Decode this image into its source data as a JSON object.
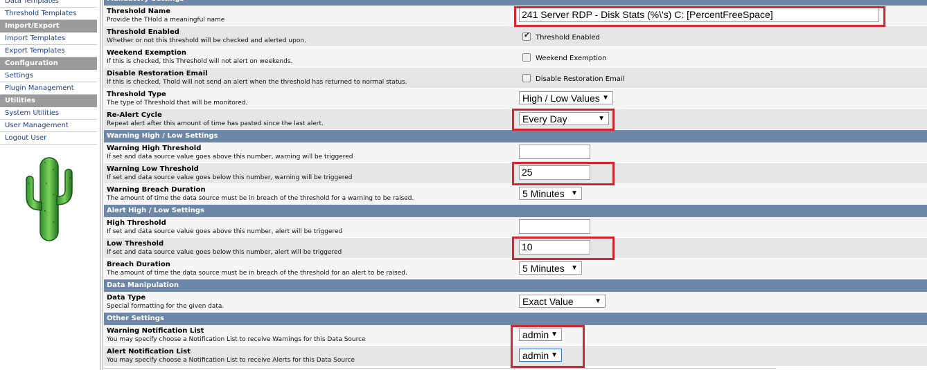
{
  "sidebar": {
    "links_top": [
      {
        "label": "Data Templates"
      },
      {
        "label": "Threshold Templates"
      }
    ],
    "groups": [
      {
        "header": "Import/Export",
        "items": [
          {
            "label": "Import Templates"
          },
          {
            "label": "Export Templates"
          }
        ]
      },
      {
        "header": "Configuration",
        "items": [
          {
            "label": "Settings"
          },
          {
            "label": "Plugin Management"
          }
        ]
      },
      {
        "header": "Utilities",
        "items": [
          {
            "label": "System Utilities"
          },
          {
            "label": "User Management"
          },
          {
            "label": "Logout User"
          }
        ]
      }
    ],
    "logo": "cactus-logo"
  },
  "sections": {
    "mandatory": "Mandatory Settings",
    "warning": "Warning High / Low Settings",
    "alert": "Alert High / Low Settings",
    "data_manip": "Data Manipulation",
    "other": "Other Settings"
  },
  "fields": {
    "threshold_name": {
      "label": "Threshold Name",
      "desc": "Provide the THold a meaningful name",
      "value": "241 Server RDP - Disk Stats (%\\'s) C: [PercentFreeSpace]"
    },
    "threshold_enabled": {
      "label": "Threshold Enabled",
      "desc": "Whether or not this threshold will be checked and alerted upon.",
      "checkbox_label": "Threshold Enabled",
      "checked": true
    },
    "weekend_exemption": {
      "label": "Weekend Exemption",
      "desc": "If this is checked, this Threshold will not alert on weekends.",
      "checkbox_label": "Weekend Exemption",
      "checked": false
    },
    "disable_restoration": {
      "label": "Disable Restoration Email",
      "desc": "If this is checked, Thold will not send an alert when the threshold has returned to normal status.",
      "checkbox_label": "Disable Restoration Email",
      "checked": false
    },
    "threshold_type": {
      "label": "Threshold Type",
      "desc": "The type of Threshold that will be monitored.",
      "value": "High / Low Values"
    },
    "realert_cycle": {
      "label": "Re-Alert Cycle",
      "desc": "Repeat alert after this amount of time has pasted since the last alert.",
      "value": "Every Day"
    },
    "warning_high": {
      "label": "Warning High Threshold",
      "desc": "If set and data source value goes above this number, warning will be triggered",
      "value": ""
    },
    "warning_low": {
      "label": "Warning Low Threshold",
      "desc": "If set and data source value goes below this number, warning will be triggered",
      "value": "25"
    },
    "warning_breach": {
      "label": "Warning Breach Duration",
      "desc": "The amount of time the data source must be in breach of the threshold for a warning to be raised.",
      "value": "5 Minutes"
    },
    "high_threshold": {
      "label": "High Threshold",
      "desc": "If set and data source value goes above this number, alert will be triggered",
      "value": ""
    },
    "low_threshold": {
      "label": "Low Threshold",
      "desc": "If set and data source value goes below this number, alert will be triggered",
      "value": "10"
    },
    "breach_duration": {
      "label": "Breach Duration",
      "desc": "The amount of time the data source must be in breach of the threshold for an alert to be raised.",
      "value": "5 Minutes"
    },
    "data_type": {
      "label": "Data Type",
      "desc": "Special formatting for the given data.",
      "value": "Exact Value"
    },
    "warning_notification": {
      "label": "Warning Notification List",
      "desc": "You may specify choose a Notification List to receive Warnings for this Data Source",
      "value": "admin"
    },
    "alert_notification": {
      "label": "Alert Notification List",
      "desc": "You may specify choose a Notification List to receive Alerts for this Data Source",
      "value": "admin"
    }
  },
  "colors": {
    "highlight": "#d9232e",
    "section_header": "#6d87a8",
    "sidebar_header": "#9b9b9b",
    "link": "#1a3f8f"
  }
}
